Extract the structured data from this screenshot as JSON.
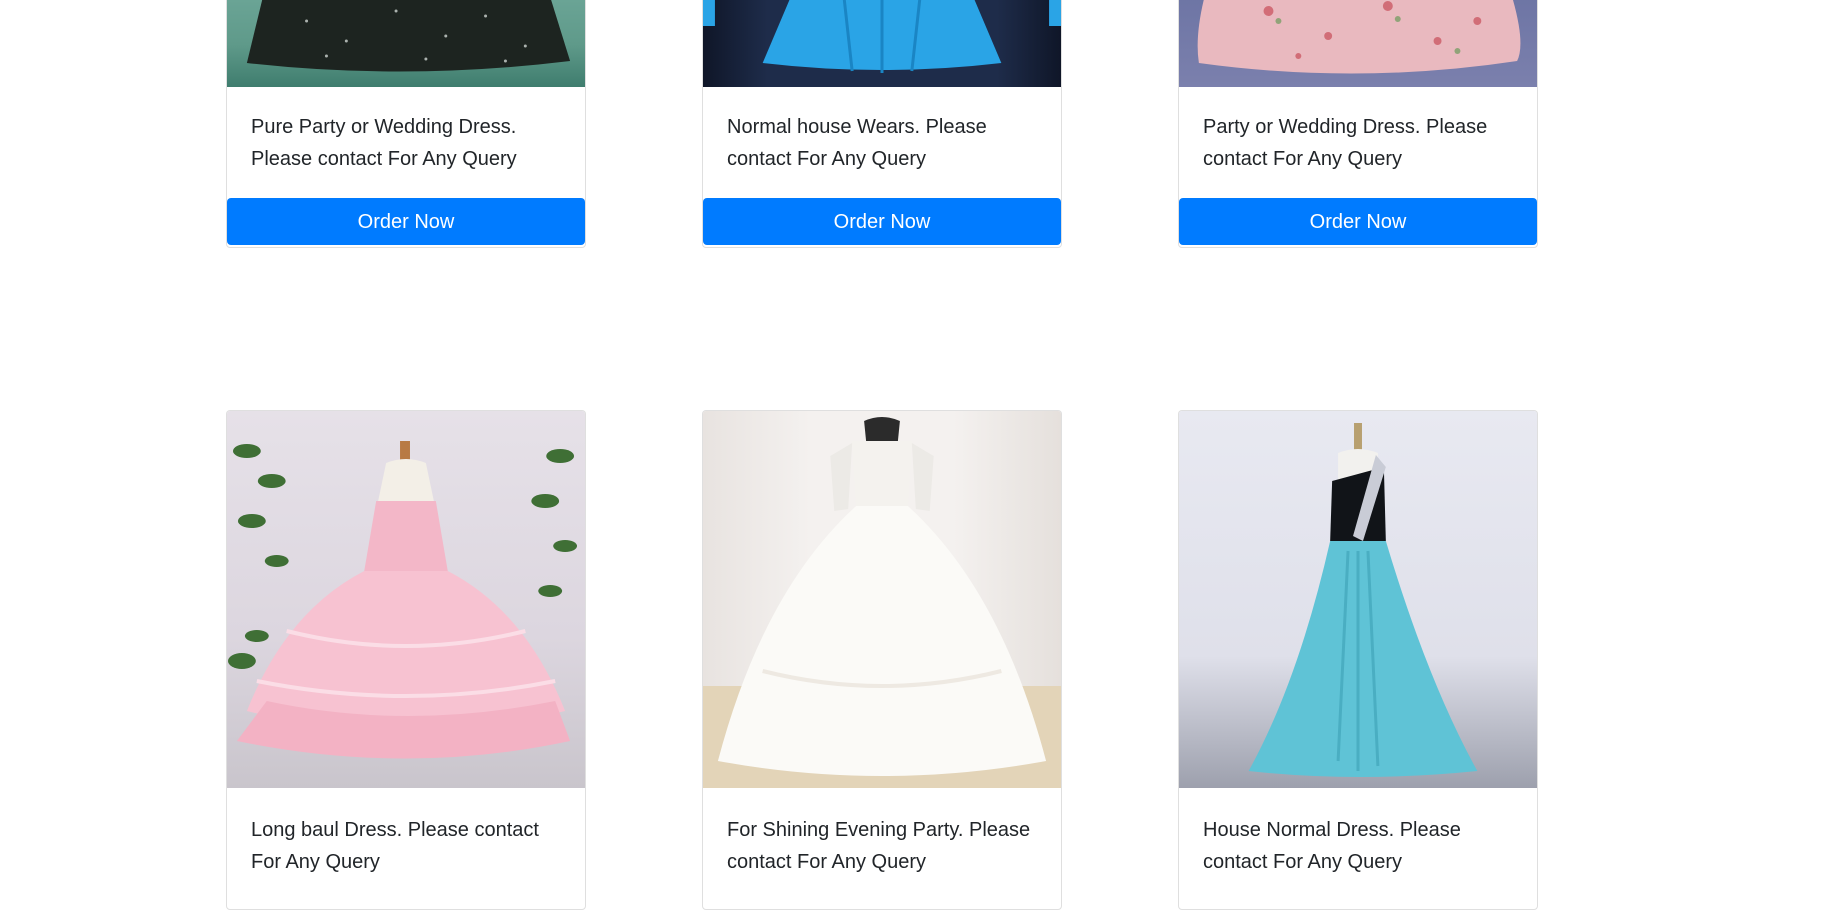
{
  "products": [
    {
      "description": "Pure Party or Wedding Dress. Please contact For Any Query",
      "button": "Order Now",
      "image": "black-sequin-ball-gown-photo"
    },
    {
      "description": "Normal house Wears. Please contact For Any Query",
      "button": "Order Now",
      "image": "blue-satin-gown-photo"
    },
    {
      "description": "Party or Wedding Dress. Please contact For Any Query",
      "button": "Order Now",
      "image": "pink-floral-gown-photo"
    },
    {
      "description": "Long baul Dress. Please contact For Any Query",
      "image": "pink-ruffled-ball-gown-photo"
    },
    {
      "description": "For Shining Evening Party. Please contact For Any Query",
      "image": "white-wedding-gown-photo"
    },
    {
      "description": "House Normal Dress. Please contact For Any Query",
      "image": "aqua-one-shoulder-gown-photo"
    }
  ],
  "colors": {
    "button": "#007bff",
    "button_text": "#ffffff",
    "text": "#212529"
  }
}
